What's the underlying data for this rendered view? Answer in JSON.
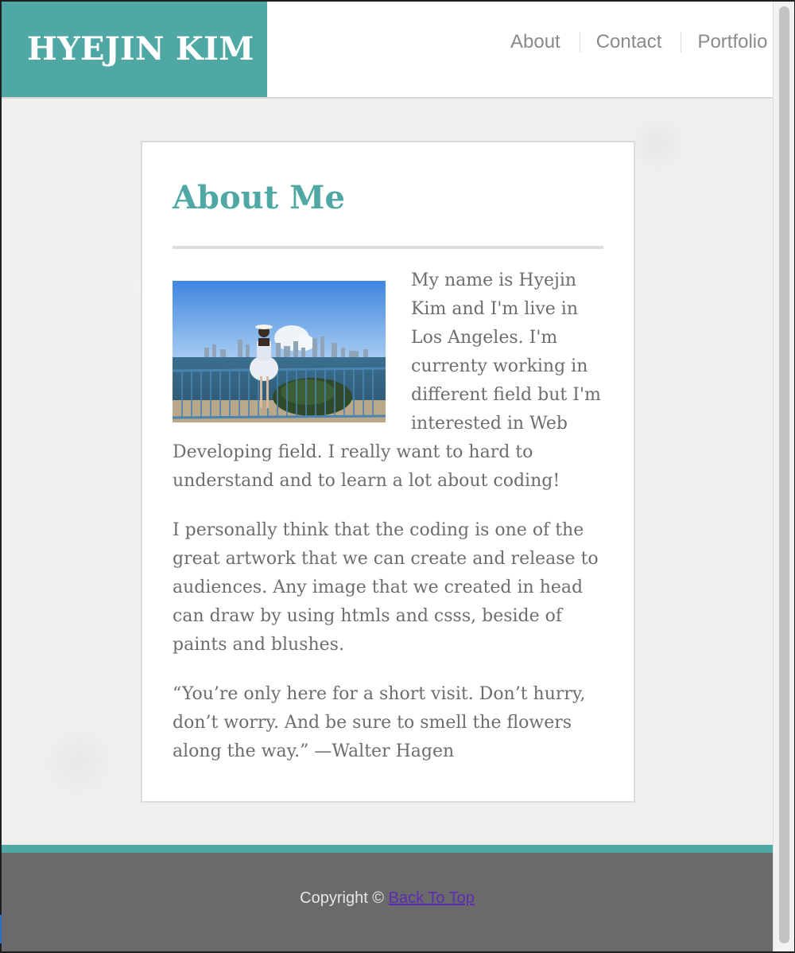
{
  "header": {
    "site_title": "HYEJIN KIM",
    "nav": [
      {
        "label": "About"
      },
      {
        "label": "Contact"
      },
      {
        "label": "Portfolio"
      }
    ]
  },
  "main": {
    "heading": "About Me",
    "paragraphs": [
      "My name is Hyejin Kim and I'm live in Los Angeles. I'm currenty working in different field but I'm interested in Web Developing field. I really want to hard to understand and to learn a lot about coding!",
      "I personally think that the coding is one of the great artwork that we can create and release to audiences. Any image that we created in head can draw by using htmls and csss, beside of paints and blushes.",
      "“You’re only here for a short visit. Don’t hurry, don’t worry. And be sure to smell the flowers along the way.” —Walter Hagen"
    ]
  },
  "footer": {
    "copyright": "Copyright © ",
    "back_to_top": "Back To Top"
  },
  "colors": {
    "accent": "#4fa8a4",
    "text": "#6d6d6d",
    "footer_bg": "#6a6a6a",
    "link_visited": "#5a2bb3"
  }
}
